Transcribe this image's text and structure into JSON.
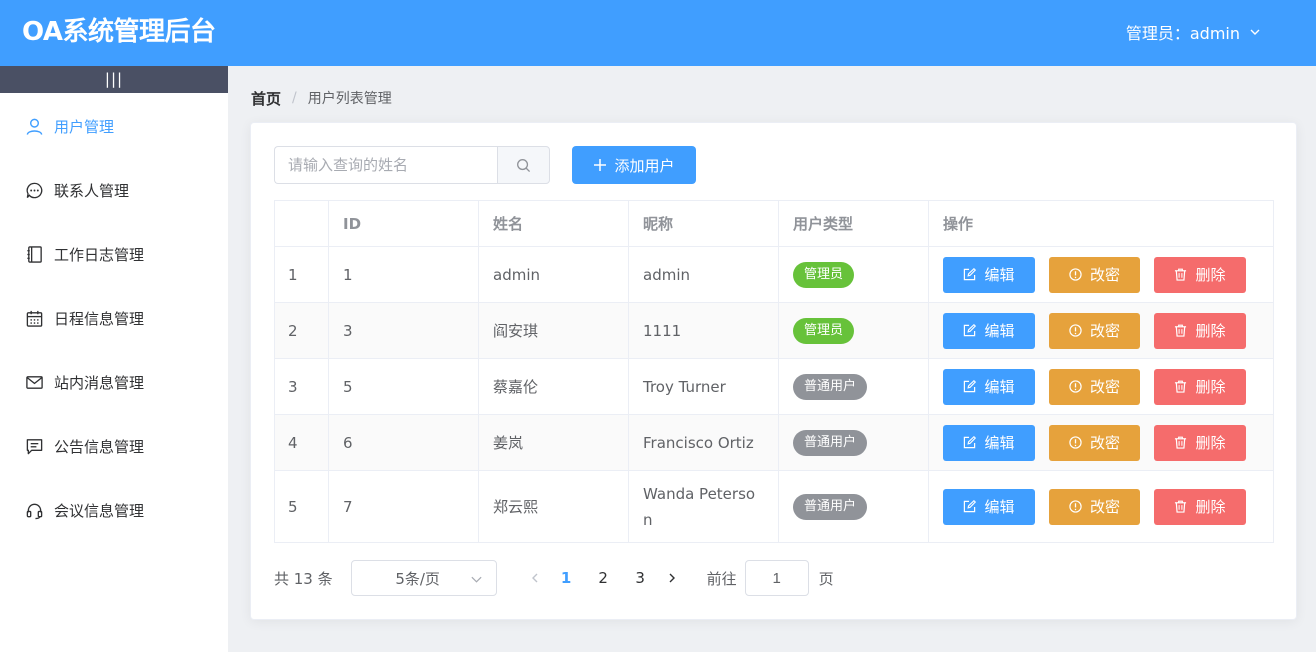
{
  "header": {
    "title": "OA系统管理后台",
    "user_label": "管理员：admin"
  },
  "sidebar": {
    "collapse_label": "|||",
    "items": [
      {
        "label": "用户管理",
        "icon": "user-icon",
        "active": true
      },
      {
        "label": "联系人管理",
        "icon": "chat-dots-icon"
      },
      {
        "label": "工作日志管理",
        "icon": "notebook-icon"
      },
      {
        "label": "日程信息管理",
        "icon": "calendar-icon"
      },
      {
        "label": "站内消息管理",
        "icon": "message-icon"
      },
      {
        "label": "公告信息管理",
        "icon": "chat-square-icon"
      },
      {
        "label": "会议信息管理",
        "icon": "headset-icon"
      }
    ]
  },
  "breadcrumb": {
    "home": "首页",
    "separator": "/",
    "current": "用户列表管理"
  },
  "toolbar": {
    "search_placeholder": "请输入查询的姓名",
    "search_value": "",
    "add_label": "添加用户"
  },
  "table": {
    "columns": [
      "",
      "ID",
      "姓名",
      "昵称",
      "用户类型",
      "操作"
    ],
    "rows": [
      {
        "index": "1",
        "id": "1",
        "name": "admin",
        "nickname": "admin",
        "type": "管理员",
        "type_kind": "admin"
      },
      {
        "index": "2",
        "id": "3",
        "name": "阎安琪",
        "nickname": "1111",
        "type": "管理员",
        "type_kind": "admin"
      },
      {
        "index": "3",
        "id": "5",
        "name": "蔡嘉伦",
        "nickname": "Troy Turner",
        "type": "普通用户",
        "type_kind": "user"
      },
      {
        "index": "4",
        "id": "6",
        "name": "姜岚",
        "nickname": "Francisco Ortiz",
        "type": "普通用户",
        "type_kind": "user"
      },
      {
        "index": "5",
        "id": "7",
        "name": "郑云熙",
        "nickname": "Wanda Peterson",
        "type": "普通用户",
        "type_kind": "user"
      }
    ],
    "actions": {
      "edit": "编辑",
      "change_password": "改密",
      "delete": "删除"
    }
  },
  "pagination": {
    "total_label": "共 13 条",
    "page_size": "5条/页",
    "pages": [
      "1",
      "2",
      "3"
    ],
    "current_page": "1",
    "goto_label": "前往",
    "goto_value": "1",
    "page_unit": "页"
  },
  "colors": {
    "primary": "#409eff",
    "warning": "#e6a23c",
    "danger": "#f56c6c",
    "success": "#67c23a",
    "info": "#909399"
  }
}
